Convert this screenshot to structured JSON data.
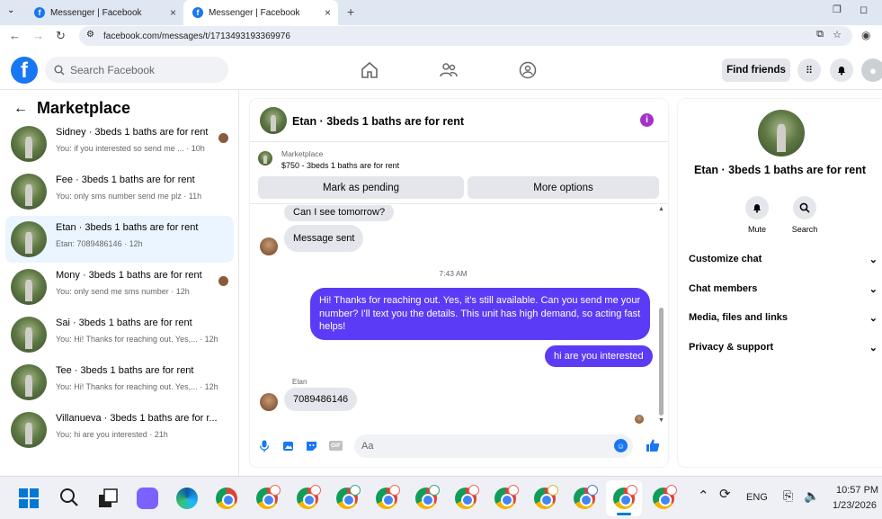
{
  "browser": {
    "tabs": [
      {
        "title": "Messenger | Facebook"
      },
      {
        "title": "Messenger | Facebook"
      }
    ],
    "url": "facebook.com/messages/t/1713493193369976"
  },
  "header": {
    "search_placeholder": "Search Facebook",
    "find_friends": "Find friends"
  },
  "sidebar": {
    "title": "Marketplace",
    "conversations": [
      {
        "name": "Sidney · 3beds 1 baths are for rent",
        "preview": "You: if you interested so send me ...",
        "time": "· 10h"
      },
      {
        "name": "Fee · 3beds 1 baths are for rent",
        "preview": "You: only sms number send me plz",
        "time": "· 11h"
      },
      {
        "name": "Etan · 3beds 1 baths are for rent",
        "preview": "Etan: 7089486146",
        "time": "· 12h"
      },
      {
        "name": "Mony · 3beds 1 baths are for rent",
        "preview": "You: only send me sms number",
        "time": "· 12h"
      },
      {
        "name": "Sai · 3beds 1 baths are for rent",
        "preview": "You: Hi! Thanks for reaching out. Yes,...",
        "time": "· 12h"
      },
      {
        "name": "Tee · 3beds 1 baths are for rent",
        "preview": "You: Hi! Thanks for reaching out. Yes,...",
        "time": "· 12h"
      },
      {
        "name": "Villanueva · 3beds 1 baths are for r...",
        "preview": "You: hi are you interested",
        "time": "· 21h"
      }
    ]
  },
  "chat": {
    "title": "Etan · 3beds 1 baths are for rent",
    "marketplace_label": "Marketplace",
    "listing": "$750 - 3beds 1 baths are for rent",
    "mark_pending": "Mark as pending",
    "more_options": "More options",
    "messages": {
      "m1": "Can I see tomorrow?",
      "m2": "Message sent",
      "timestamp": "7:43 AM",
      "m3": "Hi! Thanks for reaching out. Yes, it's still available. Can you send me your number? I'll text you the details. This unit has high demand, so acting fast helps!",
      "m4": "hi are you interested",
      "sender_label": "Etan",
      "m5": "7089486146"
    },
    "composer_placeholder": "Aa"
  },
  "details": {
    "name": "Etan · 3beds 1 baths are for rent",
    "mute": "Mute",
    "search": "Search",
    "sections": [
      "Customize chat",
      "Chat members",
      "Media, files and links",
      "Privacy & support"
    ]
  },
  "taskbar": {
    "language": "ENG",
    "time": "10:57 PM",
    "date": "1/23/2026"
  },
  "colors": {
    "brand": "#1877f2",
    "outgoing_bubble": "#5b3bf5",
    "incoming_bubble": "#e4e6eb"
  }
}
